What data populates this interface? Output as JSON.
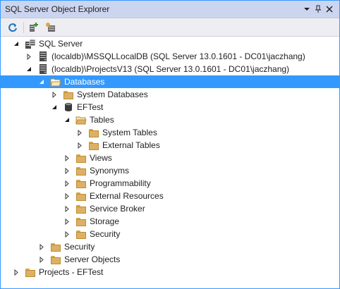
{
  "window": {
    "title": "SQL Server Object Explorer"
  },
  "titlebar": {
    "dropdown_icon": "chevron-down-icon",
    "pin_icon": "pin-icon",
    "close_icon": "close-icon"
  },
  "toolbar": {
    "tools": [
      {
        "name": "refresh-icon"
      },
      {
        "name": "add-sql-server-icon"
      },
      {
        "name": "filter-settings-icon"
      }
    ]
  },
  "tree": {
    "nodes": [
      {
        "label": "SQL Server",
        "level": 0,
        "expand": "expanded",
        "icon": "server-group-icon"
      },
      {
        "label": "(localdb)\\MSSQLLocalDB (SQL Server 13.0.1601 - DC01\\jaczhang)",
        "level": 1,
        "expand": "collapsed",
        "icon": "server-instance-icon"
      },
      {
        "label": "(localdb)\\ProjectsV13 (SQL Server 13.0.1601 - DC01\\jaczhang)",
        "level": 1,
        "expand": "expanded",
        "icon": "server-instance-icon"
      },
      {
        "label": "Databases",
        "level": 2,
        "expand": "expanded",
        "icon": "folder-open-icon",
        "selected": true
      },
      {
        "label": "System Databases",
        "level": 3,
        "expand": "collapsed",
        "icon": "folder-icon"
      },
      {
        "label": "EFTest",
        "level": 3,
        "expand": "expanded",
        "icon": "database-icon"
      },
      {
        "label": "Tables",
        "level": 4,
        "expand": "expanded",
        "icon": "folder-open-icon"
      },
      {
        "label": "System Tables",
        "level": 5,
        "expand": "collapsed",
        "icon": "folder-icon"
      },
      {
        "label": "External Tables",
        "level": 5,
        "expand": "collapsed",
        "icon": "folder-icon"
      },
      {
        "label": "Views",
        "level": 4,
        "expand": "collapsed",
        "icon": "folder-icon"
      },
      {
        "label": "Synonyms",
        "level": 4,
        "expand": "collapsed",
        "icon": "folder-icon"
      },
      {
        "label": "Programmability",
        "level": 4,
        "expand": "collapsed",
        "icon": "folder-icon"
      },
      {
        "label": "External Resources",
        "level": 4,
        "expand": "collapsed",
        "icon": "folder-icon"
      },
      {
        "label": "Service Broker",
        "level": 4,
        "expand": "collapsed",
        "icon": "folder-icon"
      },
      {
        "label": "Storage",
        "level": 4,
        "expand": "collapsed",
        "icon": "folder-icon"
      },
      {
        "label": "Security",
        "level": 4,
        "expand": "collapsed",
        "icon": "folder-icon"
      },
      {
        "label": "Security",
        "level": 2,
        "expand": "collapsed",
        "icon": "folder-icon"
      },
      {
        "label": "Server Objects",
        "level": 2,
        "expand": "collapsed",
        "icon": "folder-icon"
      },
      {
        "label": "Projects - EFTest",
        "level": 0,
        "expand": "collapsed",
        "icon": "folder-icon"
      }
    ]
  },
  "colors": {
    "titlebar_bg": "#ccd5f0",
    "selection": "#3399ff",
    "folder": "#dcb067"
  }
}
